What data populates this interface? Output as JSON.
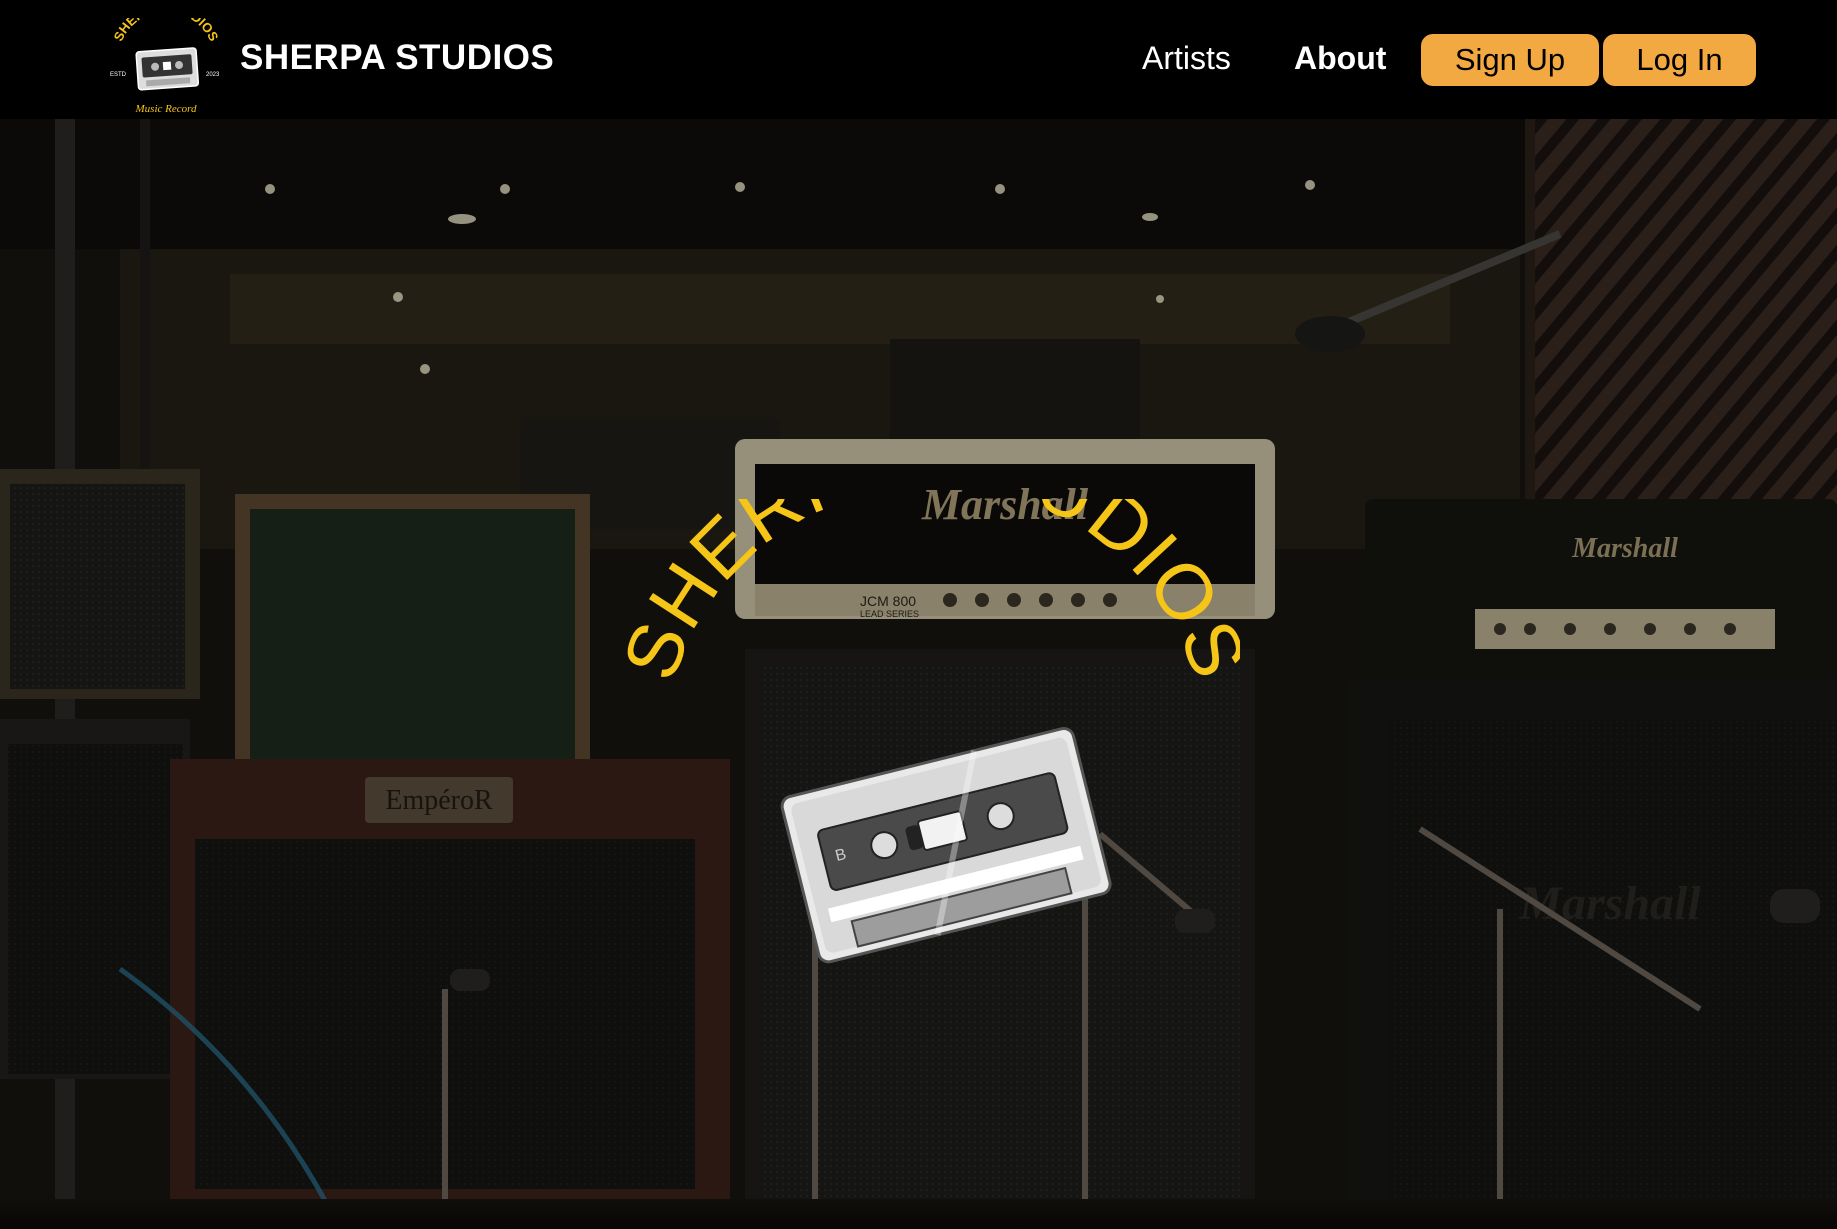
{
  "brand": {
    "name": "SHERPA STUDIOS",
    "logo": {
      "arc_text": "SHERPA STUDIOS",
      "left_text": "ESTD",
      "right_text": "2023",
      "bottom_text": "Music Record"
    }
  },
  "nav": {
    "artists_label": "Artists",
    "about_label": "About",
    "signup_label": "Sign Up",
    "login_label": "Log In"
  },
  "hero": {
    "logo_arc_text": "SHERPA STUDIOS",
    "amp_brands": [
      "Marshall",
      "Marshall",
      "Marshall"
    ],
    "amp_model": "JCM 800",
    "amp_series": "LEAD SERIES",
    "combo_brand": "EmpéroR"
  },
  "colors": {
    "accent": "#f3a941",
    "logo_yellow": "#f5c518",
    "nav_bg": "#000000",
    "text": "#ffffff"
  }
}
